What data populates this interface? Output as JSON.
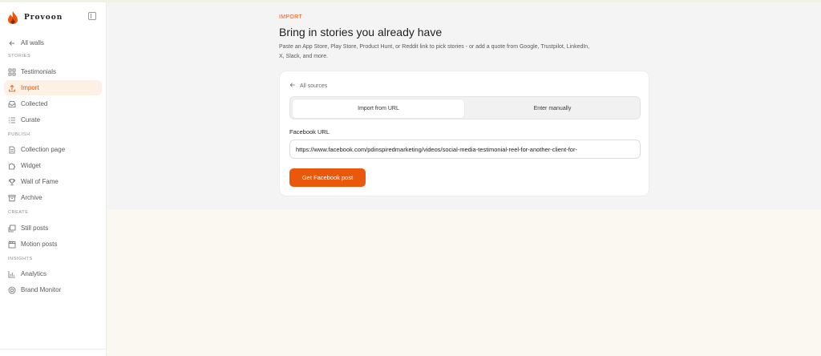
{
  "app": {
    "brand_name": "Provoon"
  },
  "sidebar": {
    "back_label": "All walls",
    "sections": {
      "stories": "STORIES",
      "publish": "PUBLISH",
      "create": "CREATE",
      "insights": "INSIGHTS"
    },
    "items": {
      "testimonials": "Testimonials",
      "import": "Import",
      "collected": "Collected",
      "curate": "Curate",
      "collection_page": "Collection page",
      "widget": "Widget",
      "wall_of_fame": "Wall of Fame",
      "archive": "Archive",
      "still_posts": "Still posts",
      "motion_posts": "Motion posts",
      "analytics": "Analytics",
      "brand_monitor": "Brand Monitor"
    },
    "active_item": "import"
  },
  "main": {
    "eyebrow": "IMPORT",
    "title": "Bring in stories you already have",
    "description": "Paste an App Store, Play Store, Product Hunt, or Reddit link to pick stories - or add a quote from Google, Trustpilot, LinkedIn, X, Slack, and more.",
    "card": {
      "back_label": "All sources",
      "tabs": {
        "url": "Import from URL",
        "manual": "Enter manually"
      },
      "active_tab": "url",
      "field_label": "Facebook URL",
      "url_value": "https://www.facebook.com/pdinspiredmarketing/videos/social-media-testimonial-reel-for-another-client-for-",
      "submit_label": "Get Facebook post"
    }
  },
  "colors": {
    "accent": "#ea580c",
    "active_bg": "#fdf0e4",
    "page_top": "#f4f4f4",
    "page_bottom": "#fbf8f1"
  },
  "icons": {
    "brand": "flame-logo",
    "collapse": "sidebar-toggle-icon",
    "back": "arrow-left-icon",
    "testimonials": "grid-icon",
    "import": "upload-icon",
    "collected": "inbox-icon",
    "curate": "list-icon",
    "collection_page": "document-icon",
    "widget": "puzzle-icon",
    "wall_of_fame": "trophy-icon",
    "archive": "archive-box-icon",
    "still_posts": "image-stack-icon",
    "motion_posts": "clapperboard-icon",
    "analytics": "bar-chart-icon",
    "brand_monitor": "radar-icon"
  }
}
